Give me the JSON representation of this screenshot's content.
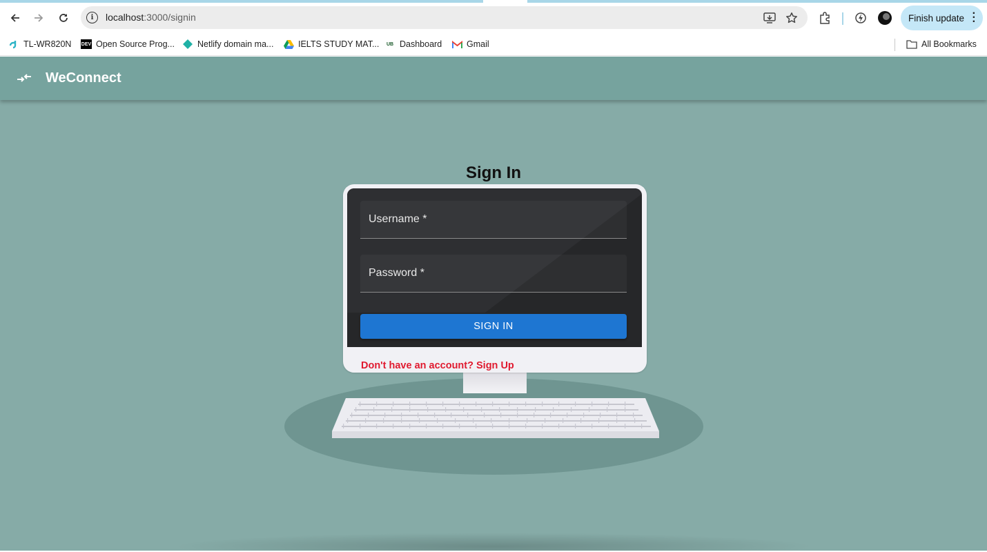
{
  "browser": {
    "url_host": "localhost",
    "url_path": ":3000/signin",
    "finish_update_label": "Finish update",
    "all_bookmarks_label": "All Bookmarks",
    "bookmarks": [
      {
        "label": "TL-WR820N",
        "icon": "tplink-icon"
      },
      {
        "label": "Open Source Prog...",
        "icon": "dev-icon"
      },
      {
        "label": "Netlify domain ma...",
        "icon": "netlify-icon"
      },
      {
        "label": "IELTS STUDY MAT...",
        "icon": "google-drive-icon"
      },
      {
        "label": "Dashboard",
        "icon": "dashboard-icon"
      },
      {
        "label": "Gmail",
        "icon": "gmail-icon"
      }
    ]
  },
  "app": {
    "brand": "WeConnect",
    "title": "Sign In",
    "username_label": "Username *",
    "password_label": "Password *",
    "signin_button": "SIGN IN",
    "signup_link": "Don't have an account? Sign Up"
  },
  "colors": {
    "background": "#86aba7",
    "appbar": "#76a39e",
    "button": "#1e76d2",
    "link": "#e01a2f"
  }
}
